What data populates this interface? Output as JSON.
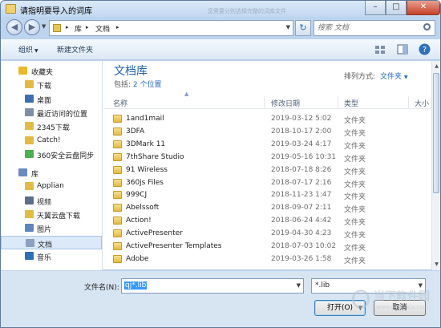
{
  "window": {
    "title": "请指明要导入的词库",
    "ghost_text": "您需要分别选择完整的词库文件",
    "minimize": "–",
    "maximize": "□",
    "close": "✕"
  },
  "nav": {
    "back": "◀",
    "forward": "▶",
    "dropdown": "▼"
  },
  "address": {
    "sep0": "▸",
    "part1": "库",
    "sep1": "▸",
    "part2": "文档",
    "sep2": "▸",
    "dropdown": "▼"
  },
  "search": {
    "placeholder": "搜索 文档"
  },
  "toolbar": {
    "organize": "组织",
    "organize_arrow": "▼",
    "new_folder": "新建文件夹"
  },
  "sidebar": {
    "items": [
      {
        "label": "收藏夹",
        "icon": "star-icon",
        "color": "#e9b928",
        "head": true
      },
      {
        "label": "下载",
        "icon": "download-folder-icon",
        "color": "#e2bb45"
      },
      {
        "label": "桌面",
        "icon": "desktop-icon",
        "color": "#3b6fb0"
      },
      {
        "label": "最近访问的位置",
        "icon": "recent-places-icon",
        "color": "#7d8ea7"
      },
      {
        "label": "2345下载",
        "icon": "folder-icon",
        "color": "#e2bb45"
      },
      {
        "label": "Catch!",
        "icon": "folder-icon",
        "color": "#e2bb45"
      },
      {
        "label": "360安全云盘同步",
        "icon": "cloud-drive-icon",
        "color": "#4caf50"
      },
      {
        "label": "库",
        "icon": "library-icon",
        "color": "#6a8bbd",
        "head": true
      },
      {
        "label": "Applian",
        "icon": "folder-icon",
        "color": "#e2bb45"
      },
      {
        "label": "视频",
        "icon": "video-library-icon",
        "color": "#5a6f8c"
      },
      {
        "label": "天翼云盘下载",
        "icon": "folder-icon",
        "color": "#e2bb45"
      },
      {
        "label": "图片",
        "icon": "pictures-library-icon",
        "color": "#5f86b8"
      },
      {
        "label": "文档",
        "icon": "documents-library-icon",
        "color": "#8aa2c0",
        "selected": true
      },
      {
        "label": "音乐",
        "icon": "music-library-icon",
        "color": "#2f6fb6"
      }
    ]
  },
  "library": {
    "title": "文档库",
    "includes_label": "包括:",
    "includes_link": "2 个位置",
    "arrange_label": "排列方式:",
    "arrange_value": "文件夹",
    "arrange_arrow": "▼"
  },
  "columns": {
    "name": "名称",
    "date": "修改日期",
    "type": "类型",
    "size": "大小",
    "sort_arrow": "▲"
  },
  "files": [
    {
      "name": "1and1mail",
      "date": "2019-03-12 5:02",
      "type": "文件夹"
    },
    {
      "name": "3DFA",
      "date": "2018-10-17 2:00",
      "type": "文件夹"
    },
    {
      "name": "3DMark 11",
      "date": "2019-03-24 4:17",
      "type": "文件夹"
    },
    {
      "name": "7thShare Studio",
      "date": "2019-05-16 10:31",
      "type": "文件夹"
    },
    {
      "name": "91 Wireless",
      "date": "2018-07-18 8:26",
      "type": "文件夹"
    },
    {
      "name": "360js Files",
      "date": "2018-07-17 2:16",
      "type": "文件夹"
    },
    {
      "name": "999CJ",
      "date": "2018-11-23 1:47",
      "type": "文件夹"
    },
    {
      "name": "Abelssoft",
      "date": "2018-09-07 2:11",
      "type": "文件夹"
    },
    {
      "name": "Action!",
      "date": "2018-06-24 4:42",
      "type": "文件夹"
    },
    {
      "name": "ActivePresenter",
      "date": "2019-04-30 4:23",
      "type": "文件夹"
    },
    {
      "name": "ActivePresenter Templates",
      "date": "2018-07-03 10:02",
      "type": "文件夹"
    },
    {
      "name": "Adobe",
      "date": "2019-03-26 1:58",
      "type": "文件夹"
    }
  ],
  "scrollbar": {
    "up": "▲",
    "down": "▼"
  },
  "bottom": {
    "filename_label": "文件名(N):",
    "filename_value": "qj*.lib",
    "filename_dropdown": "▼",
    "filetype_value": "*.lib",
    "filetype_dropdown": "▼",
    "open_label": "打开(O)",
    "open_dropdown": "▼",
    "cancel_label": "取消"
  },
  "watermark": {
    "line1": "当下软件园",
    "line2": "www.downxia.com"
  }
}
